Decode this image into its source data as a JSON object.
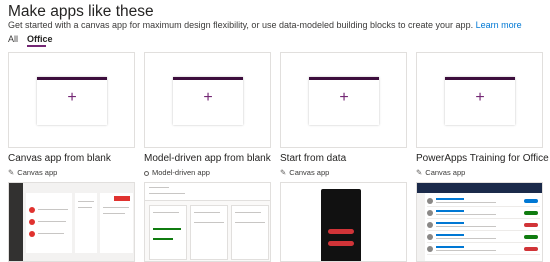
{
  "header": {
    "title": "Make apps like these",
    "subtitle": "Get started with a canvas app for maximum design flexibility, or use data-modeled building blocks to create your app.",
    "learn_more": "Learn more"
  },
  "tabs": [
    {
      "label": "All",
      "selected": false
    },
    {
      "label": "Office",
      "selected": true
    }
  ],
  "accent_color": "#742774",
  "cards": [
    {
      "title": "Canvas app from blank",
      "type": "Canvas app",
      "type_icon": "pencil-icon"
    },
    {
      "title": "Model-driven app from blank",
      "type": "Model-driven app",
      "type_icon": "model-driven-icon"
    },
    {
      "title": "Start from data",
      "type": "Canvas app",
      "type_icon": "pencil-icon"
    },
    {
      "title": "PowerApps Training for Office",
      "type": "Canvas app",
      "type_icon": "pencil-icon"
    }
  ],
  "card_plus_glyph": "+",
  "pencil_glyph": "✎"
}
